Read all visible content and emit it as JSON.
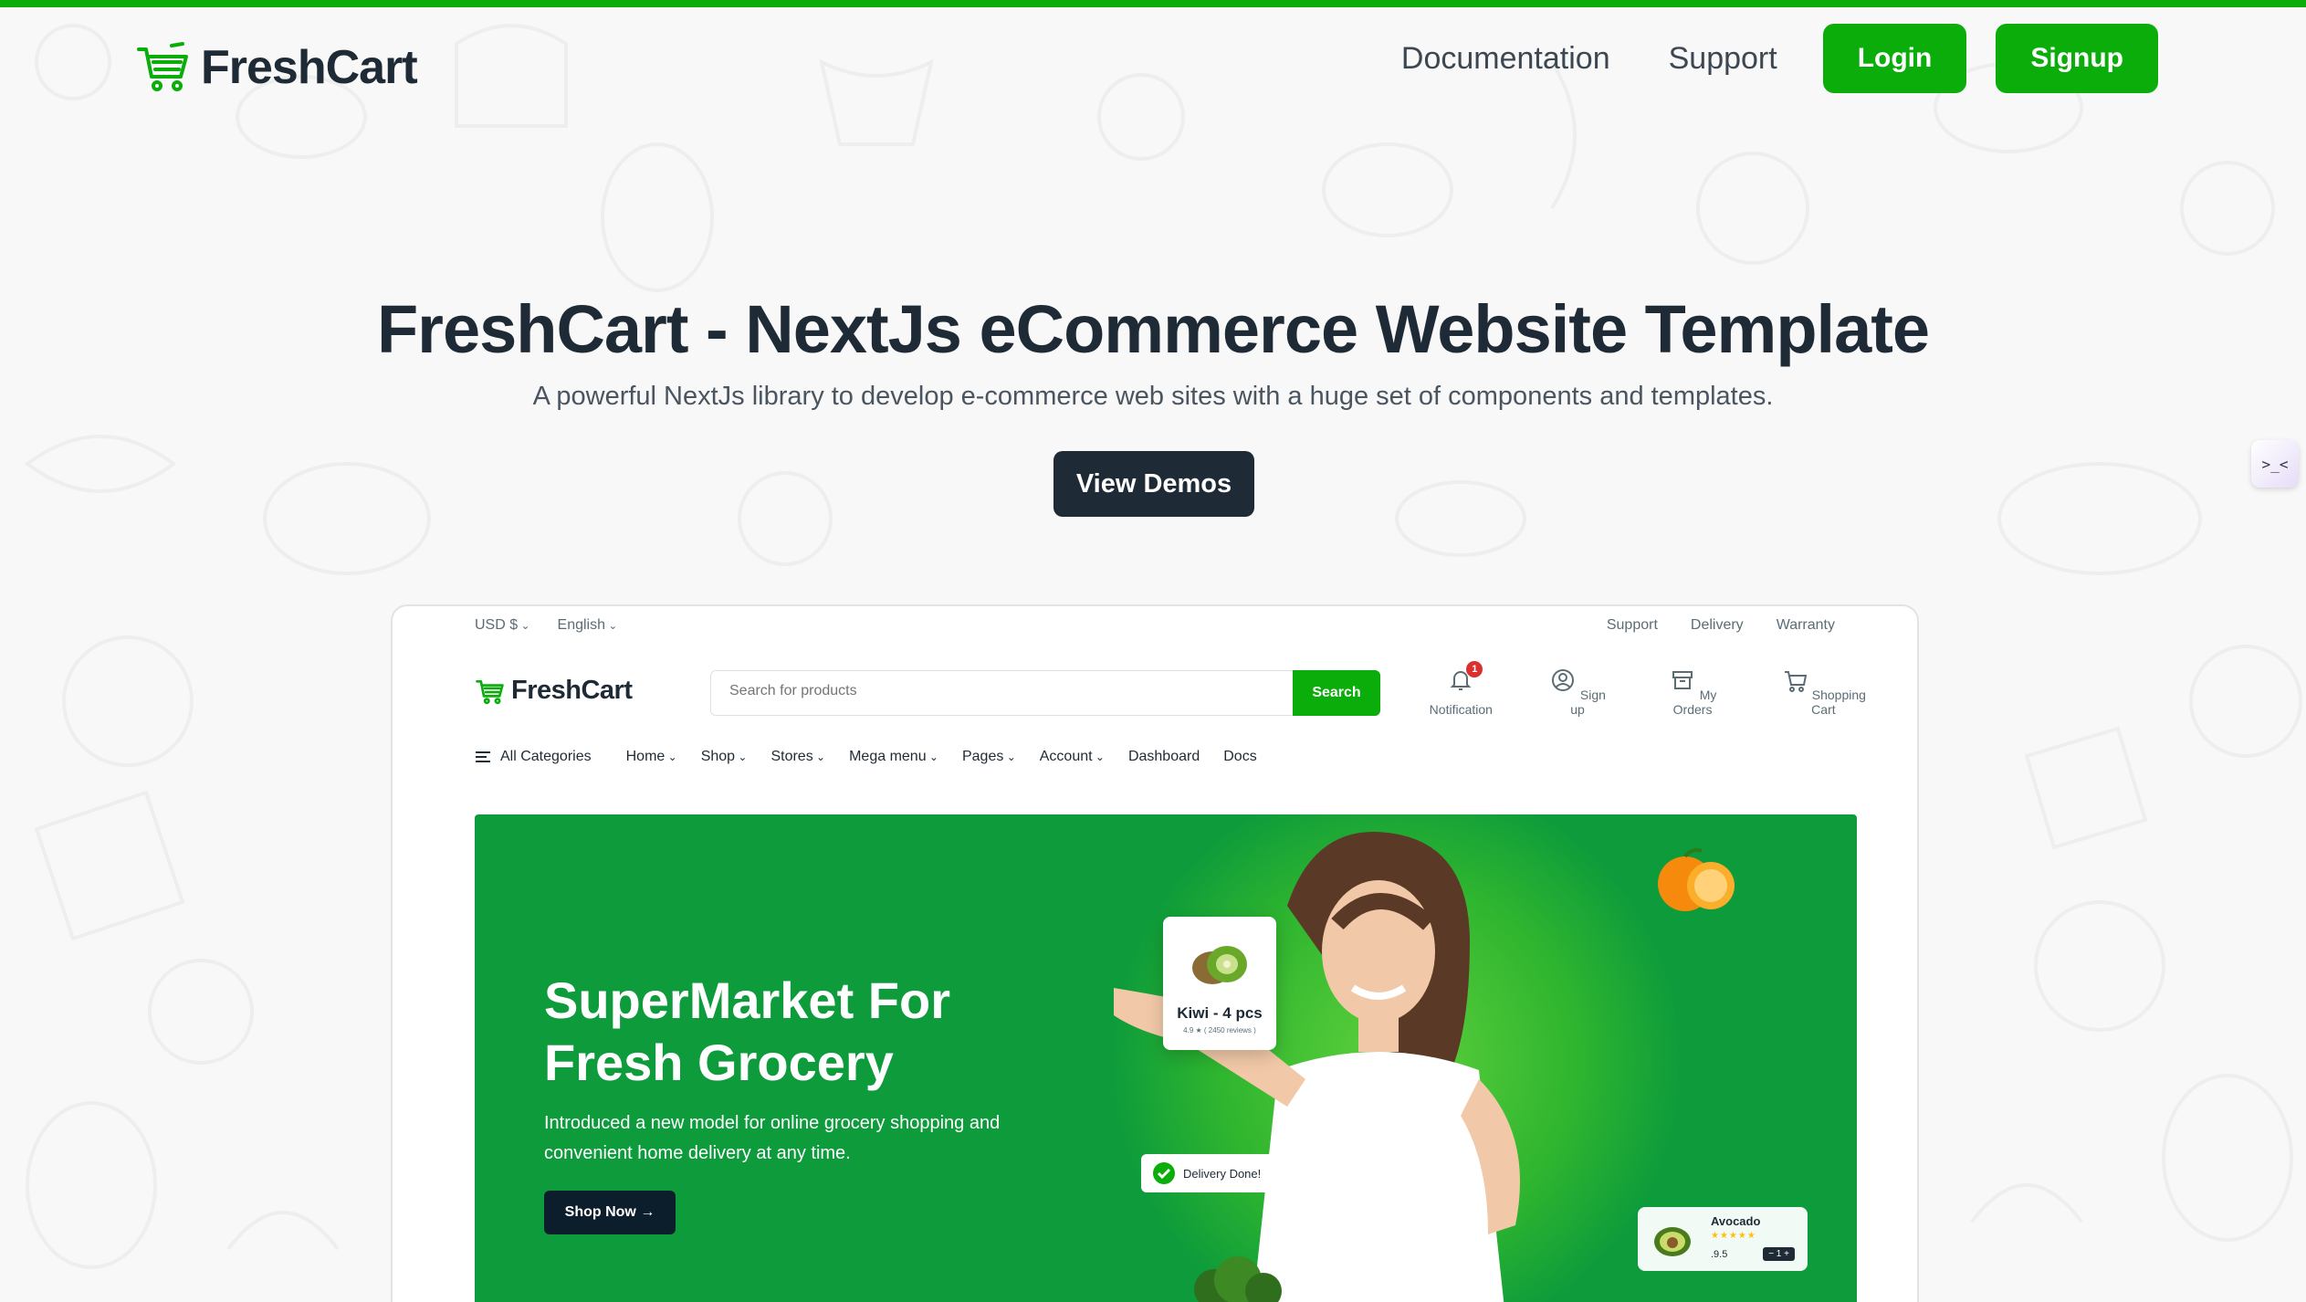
{
  "brand": {
    "name": "FreshCart",
    "accent": "#0aad0a",
    "dark": "#1e2a35"
  },
  "header": {
    "nav": [
      "Documentation",
      "Support"
    ],
    "login_label": "Login",
    "signup_label": "Signup"
  },
  "hero": {
    "title": "FreshCart - NextJs eCommerce Website Template",
    "subtitle": "A powerful NextJs library to develop e-commerce web sites with a huge set of components and templates.",
    "cta_label": "View Demos"
  },
  "side_widget": {
    "glyph": ">_<"
  },
  "preview": {
    "topbar": {
      "currency": "USD $",
      "language": "English",
      "links": [
        "Support",
        "Delivery",
        "Warranty"
      ]
    },
    "logo": "FreshCart",
    "search": {
      "placeholder": "Search for products",
      "button": "Search"
    },
    "icons": [
      {
        "label": "Notification",
        "icon": "bell-icon",
        "badge": "1"
      },
      {
        "label": "Sign up",
        "icon": "user-icon"
      },
      {
        "label": "My Orders",
        "icon": "archive-icon"
      },
      {
        "label": "Shopping Cart",
        "icon": "cart-icon"
      }
    ],
    "menu": {
      "categories": "All Categories",
      "items": [
        "Home",
        "Shop",
        "Stores",
        "Mega menu",
        "Pages",
        "Account",
        "Dashboard",
        "Docs"
      ]
    },
    "banner": {
      "title_line1": "SuperMarket For",
      "title_line2": "Fresh Grocery",
      "text": "Introduced a new model for online grocery shopping and convenient home delivery at any time.",
      "button": "Shop Now",
      "kiwi": {
        "name": "Kiwi - 4 pcs",
        "reviews": "4.9 ★ ( 2450 reviews )"
      },
      "delivery": "Delivery Done!",
      "avocado": {
        "name": "Avocado",
        "stars": "★★★★★",
        "price": ".9.5",
        "qty": "− 1 +"
      }
    }
  }
}
